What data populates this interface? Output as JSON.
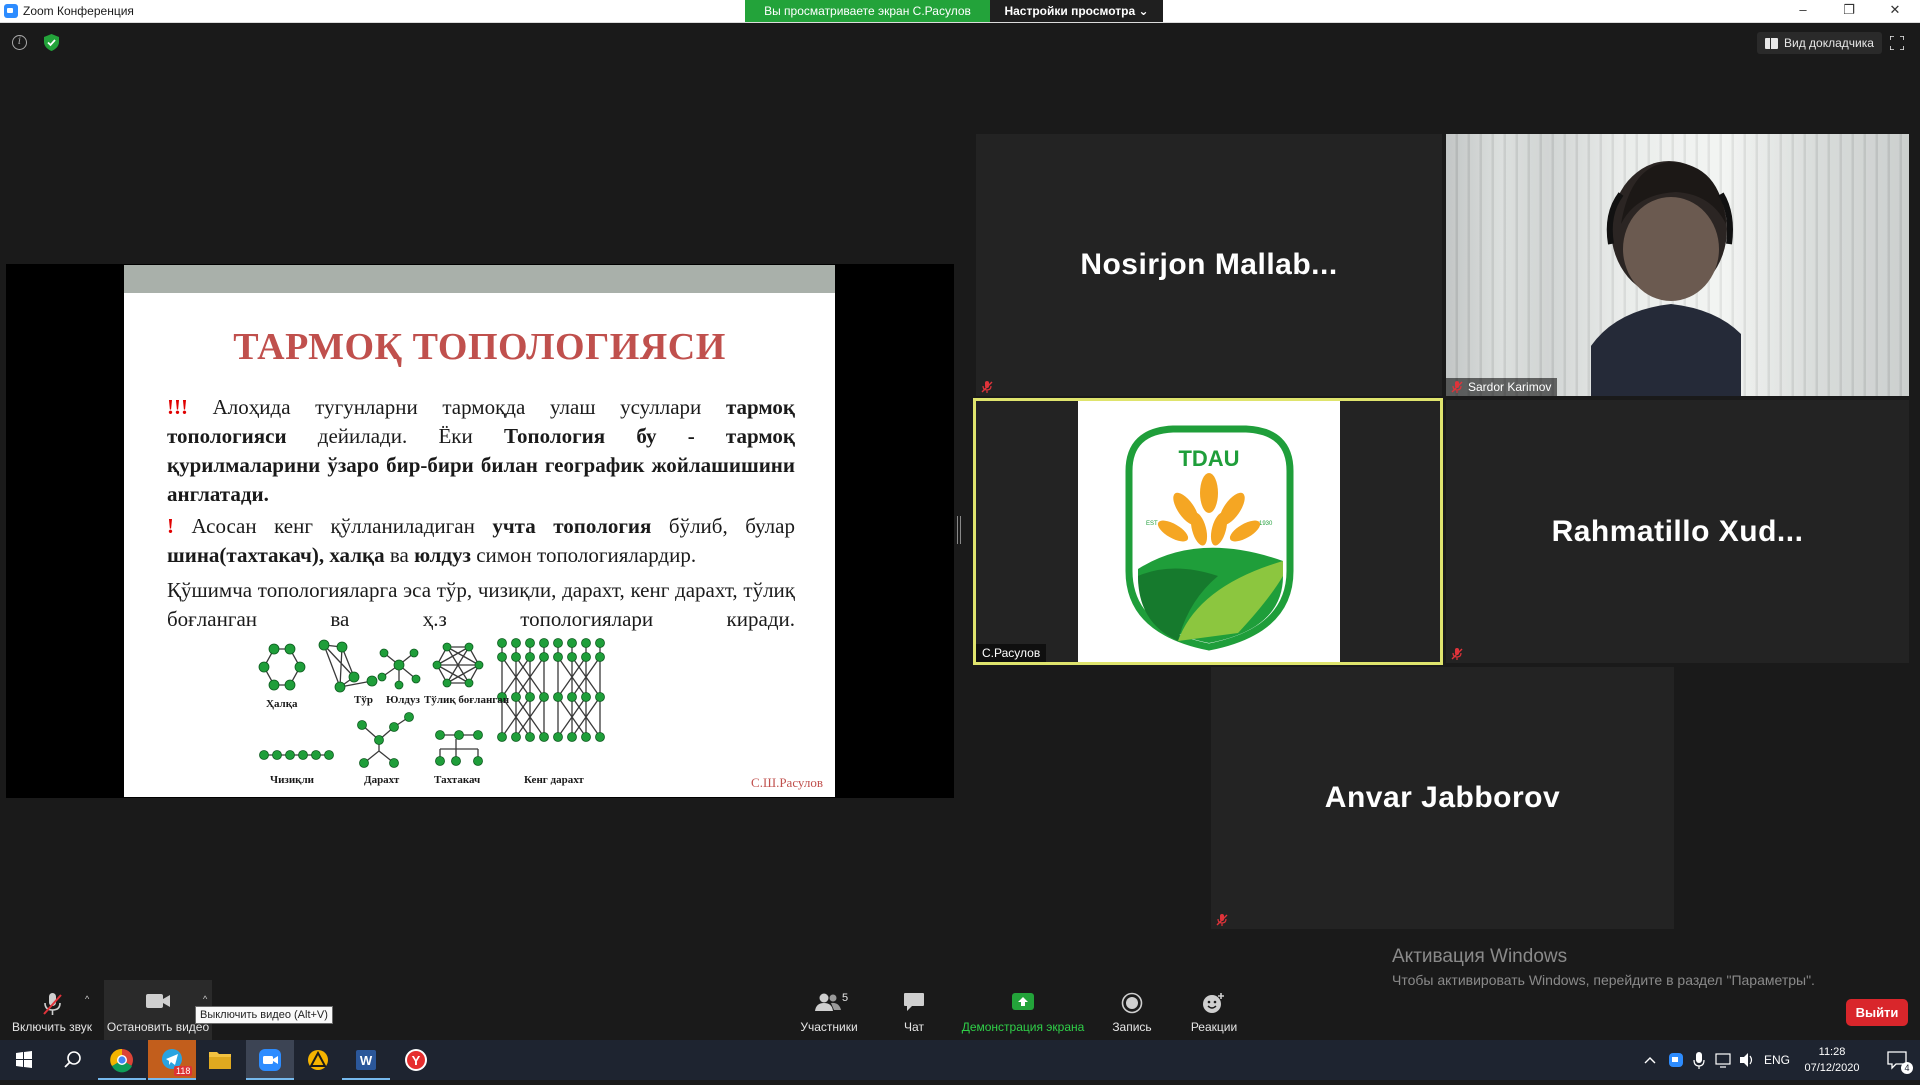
{
  "window": {
    "title": "Zoom Конференция",
    "viewing_banner": "Вы просматриваете экран С.Расулов",
    "view_settings": "Настройки просмотра",
    "minimize": "–",
    "restore": "❐",
    "close": "✕"
  },
  "top_bar": {
    "speaker_view": "Вид докладчика"
  },
  "slide": {
    "title": "ТАРМОҚ ТОПОЛОГИЯСИ",
    "p1_mark": "!!!",
    "p1_text_a": " Алоҳида тугунларни тармоқда улаш усуллари ",
    "p1_bold_a": "тармоқ топологияси",
    "p1_text_b": " дейилади. Ёки ",
    "p1_bold_b": "Топология бу - тармоқ қурилмаларини ўзаро бир-бири билан географик жойлашишини англатади.",
    "p2_mark": "!",
    "p2_text_a": " Асосан кенг қўлланиладиган ",
    "p2_bold_a": "учта топология",
    "p2_text_b": " бўлиб, булар ",
    "p2_bold_b": "шина(тахтакач), халқа",
    "p2_text_c": " ва ",
    "p2_bold_c": "юлдуз",
    "p2_text_d": " симон топологиялардир.",
    "p3_text": "Қўшимча топологияларга эса тўр, чизиқли, дарахт, кенг дарахт, тўлиқ боғланган ва ҳ.з топологиялари киради.",
    "labels": {
      "ring": "Ҳалқа",
      "mesh": "Тўр",
      "star": "Юлдуз",
      "full": "Тўлиқ боғланган",
      "linear": "Чизиқли",
      "tree": "Дарахт",
      "bus": "Тахтакач",
      "wide_tree": "Кенг дарахт"
    },
    "author": "С.Ш.Расулов"
  },
  "participants": [
    {
      "name": "Nosirjon  Mallab...",
      "muted": true,
      "video": false
    },
    {
      "name": "Sardor Karimov",
      "muted": true,
      "video": true
    },
    {
      "name": "С.Расулов",
      "muted": false,
      "video": true,
      "active_speaker": true
    },
    {
      "name": "Rahmatillo  Xud...",
      "muted": true,
      "video": false
    },
    {
      "name": "Anvar Jabborov",
      "muted": true,
      "video": false
    }
  ],
  "logo": {
    "text": "TDAU",
    "est_left": "EST",
    "est_right": "1930"
  },
  "toolbar": {
    "unmute": "Включить звук",
    "stop_video": "Остановить видео",
    "tooltip": "Выключить видео (Alt+V)",
    "participants": "Участники",
    "participants_count": "5",
    "chat": "Чат",
    "share": "Демонстрация экрана",
    "record": "Запись",
    "reactions": "Реакции",
    "leave": "Выйти"
  },
  "activation": {
    "title": "Активация Windows",
    "subtitle": "Чтобы активировать Windows, перейдите в раздел \"Параметры\"."
  },
  "taskbar": {
    "telegram_badge": "118",
    "language": "ENG",
    "time": "11:28",
    "date": "07/12/2020",
    "notifications": "4"
  },
  "colors": {
    "accent_green": "#23a33a",
    "active_border": "#dfe46d",
    "leave_red": "#d9262b",
    "slide_title": "#c0504d",
    "node_green": "#1f9e3a"
  }
}
